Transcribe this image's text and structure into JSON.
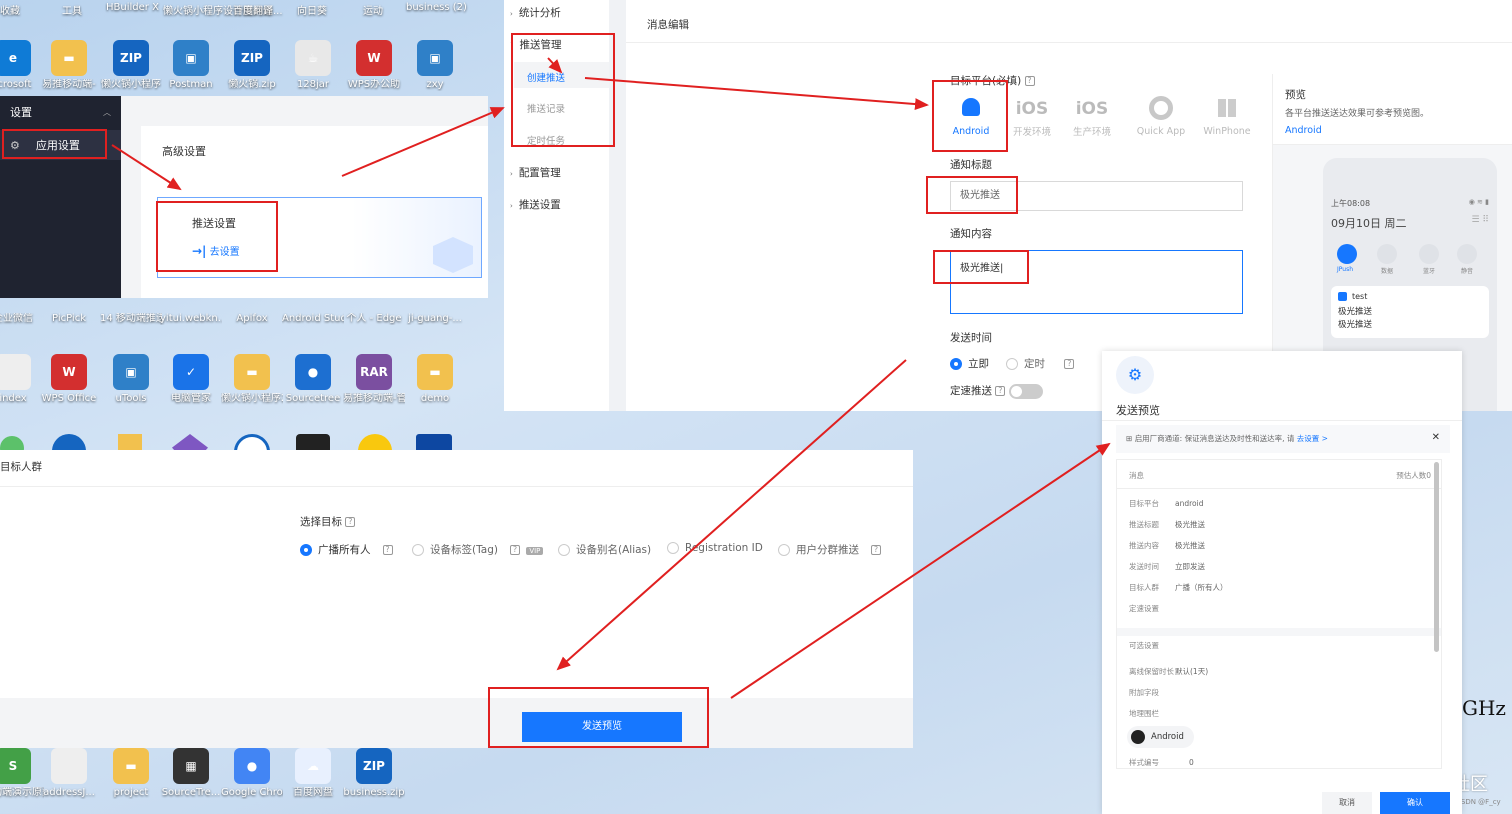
{
  "desktop": {
    "top_labels": [
      "收藏",
      "工具",
      "HBuilder X",
      "懒火锅小程序设计图问题...",
      "百度翻译",
      "向日葵",
      "运动",
      "business (2)"
    ],
    "row1": [
      {
        "label": "icrosoft",
        "icon": "edge-icon",
        "color": "#0f7bd6",
        "glyph": "e"
      },
      {
        "label": "易推移动端-",
        "icon": "folder-icon",
        "color": "#f2c14e",
        "glyph": "▬"
      },
      {
        "label": "懒火锅小程序",
        "icon": "zip-icon",
        "color": "#1565c0",
        "glyph": "ZIP"
      },
      {
        "label": "Postman",
        "icon": "window-icon",
        "color": "#2f80c8",
        "glyph": "▣"
      },
      {
        "label": "懒火锅.zip",
        "icon": "zip-icon",
        "color": "#1565c0",
        "glyph": "ZIP"
      },
      {
        "label": "128jar",
        "icon": "java-icon",
        "color": "#e8e8e8",
        "glyph": "☕"
      },
      {
        "label": "WPS办公助",
        "icon": "wps-icon",
        "color": "#d32f2f",
        "glyph": "W"
      },
      {
        "label": "zxy",
        "icon": "window-icon",
        "color": "#2f80c8",
        "glyph": "▣"
      }
    ],
    "row2": [
      {
        "label": "企业微信",
        "icon": "app-icon",
        "color": "#2b7de9",
        "glyph": ""
      },
      {
        "label": "PicPick",
        "icon": "app-icon",
        "color": "#e55a2b",
        "glyph": ""
      },
      {
        "label": "14 移动端推送手册设计.md",
        "icon": "file-icon",
        "color": "#eeeeee",
        "glyph": ""
      },
      {
        "label": "yitui.webkn...",
        "icon": "zip-icon",
        "color": "#1565c0",
        "glyph": "ZIP"
      },
      {
        "label": "Apifox",
        "icon": "app-icon",
        "color": "#e8395b",
        "glyph": ""
      },
      {
        "label": "Android Studio",
        "icon": "app-icon",
        "color": "#3ddc84",
        "glyph": ""
      },
      {
        "label": "个人 - Edge",
        "icon": "edge-icon",
        "color": "#0f7bd6",
        "glyph": ""
      },
      {
        "label": "ji-guang-...",
        "icon": "folder-icon",
        "color": "#f2c14e",
        "glyph": ""
      }
    ],
    "row3": [
      {
        "label": "index",
        "icon": "file-icon",
        "color": "#eeeeee",
        "glyph": ""
      },
      {
        "label": "WPS Office",
        "icon": "wps-icon",
        "color": "#d32f2f",
        "glyph": "W"
      },
      {
        "label": "uTools",
        "icon": "window-icon",
        "color": "#2f80c8",
        "glyph": "▣"
      },
      {
        "label": "电脑管家",
        "icon": "shield-icon",
        "color": "#1a73e8",
        "glyph": "✓"
      },
      {
        "label": "懒火锅小程序2",
        "icon": "folder-icon",
        "color": "#f2c14e",
        "glyph": "▬"
      },
      {
        "label": "Sourcetree",
        "icon": "sourcetree-icon",
        "color": "#1d6fd1",
        "glyph": "●"
      },
      {
        "label": "易推移动端-管理系统.rar",
        "icon": "rar-icon",
        "color": "#7b4fa0",
        "glyph": "RAR"
      },
      {
        "label": "demo",
        "icon": "folder-icon",
        "color": "#f2c14e",
        "glyph": "▬"
      }
    ],
    "row4": [
      {
        "label": "移动端演示原型反馈...",
        "icon": "file-icon",
        "color": "#43a047",
        "glyph": "S"
      },
      {
        "label": "addressJ...",
        "icon": "file-icon",
        "color": "#eeeeee",
        "glyph": ""
      },
      {
        "label": "project",
        "icon": "folder-icon",
        "color": "#f2c14e",
        "glyph": "▬"
      },
      {
        "label": "SourceTre...",
        "icon": "app-icon",
        "color": "#333333",
        "glyph": "▦"
      },
      {
        "label": "Google Chrome",
        "icon": "chrome-icon",
        "color": "#4285f4",
        "glyph": "●"
      },
      {
        "label": "百度网盘",
        "icon": "cloud-icon",
        "color": "#e8f0fe",
        "glyph": "☁"
      },
      {
        "label": "business.zip",
        "icon": "zip-icon",
        "color": "#1565c0",
        "glyph": "ZIP"
      }
    ],
    "corner_text": "GHz",
    "watermark": "@稀土掘金技术社区",
    "watermark_small": "CSDN @F_cy"
  },
  "settings_menu": {
    "title": "设置",
    "item": "应用设置"
  },
  "advanced": {
    "title": "高级设置",
    "card_title": "推送设置",
    "card_link": "去设置"
  },
  "nav": {
    "items": [
      {
        "label": "统计分析"
      },
      {
        "label": "推送管理"
      },
      {
        "label": "配置管理"
      },
      {
        "label": "推送设置"
      }
    ],
    "sub": [
      "创建推送",
      "推送记录",
      "定时任务"
    ]
  },
  "editor": {
    "title": "消息编辑",
    "platform_label": "目标平台(必填)",
    "platforms": [
      {
        "name": "Android",
        "active": true
      },
      {
        "name": "开发环境",
        "active": false
      },
      {
        "name": "生产环境",
        "active": false
      },
      {
        "name": "Quick App",
        "active": false
      },
      {
        "name": "WinPhone",
        "active": false
      }
    ],
    "ios_text": "iOS",
    "notify_title_label": "通知标题",
    "notify_title_value": "极光推送",
    "notify_content_label": "通知内容",
    "notify_content_value": "极光推送",
    "send_time_label": "发送时间",
    "send_now": "立即",
    "send_timed": "定时",
    "speed_label": "定速推送"
  },
  "preview": {
    "title": "预览",
    "desc": "各平台推送送达效果可参考预览图。",
    "tab": "Android",
    "phone_time": "上午08:08",
    "phone_date": "09月10日  周二",
    "quick_icons": [
      "JPush",
      "数据",
      "蓝牙",
      "静音"
    ],
    "notif_app": "test",
    "notif_line1": "极光推送",
    "notif_line2": "极光推送"
  },
  "target": {
    "title": "目标人群",
    "select_label": "选择目标",
    "options": [
      "广播所有人",
      "设备标签(Tag)",
      "设备别名(Alias)",
      "Registration ID",
      "用户分群推送"
    ],
    "vip": "VIP",
    "button": "发送预览"
  },
  "dialog": {
    "title": "发送预览",
    "notice": "启用厂商通道: 保证消息送达及时性和送达率, 请",
    "notice_link": "去设置 >",
    "section1_title": "消息",
    "section1_right": "预估人数0",
    "rows": [
      {
        "k": "目标平台",
        "v": "android"
      },
      {
        "k": "推送标题",
        "v": "极光推送"
      },
      {
        "k": "推送内容",
        "v": "极光推送"
      },
      {
        "k": "发送时间",
        "v": "立即发送"
      },
      {
        "k": "目标人群",
        "v": "广播（所有人）"
      },
      {
        "k": "定速设置",
        "v": ""
      }
    ],
    "section2_title": "可选设置",
    "rows2": [
      {
        "k": "离线保留时长",
        "v": "默认(1天)"
      },
      {
        "k": "附加字段",
        "v": ""
      },
      {
        "k": "地理围栏",
        "v": ""
      }
    ],
    "android_chip": "Android",
    "style_k": "样式编号",
    "style_v": "0",
    "cancel": "取消",
    "confirm": "确认"
  },
  "colors": {
    "primary": "#1677ff",
    "annotation": "#e02020",
    "dark_menu": "#1f2330"
  }
}
